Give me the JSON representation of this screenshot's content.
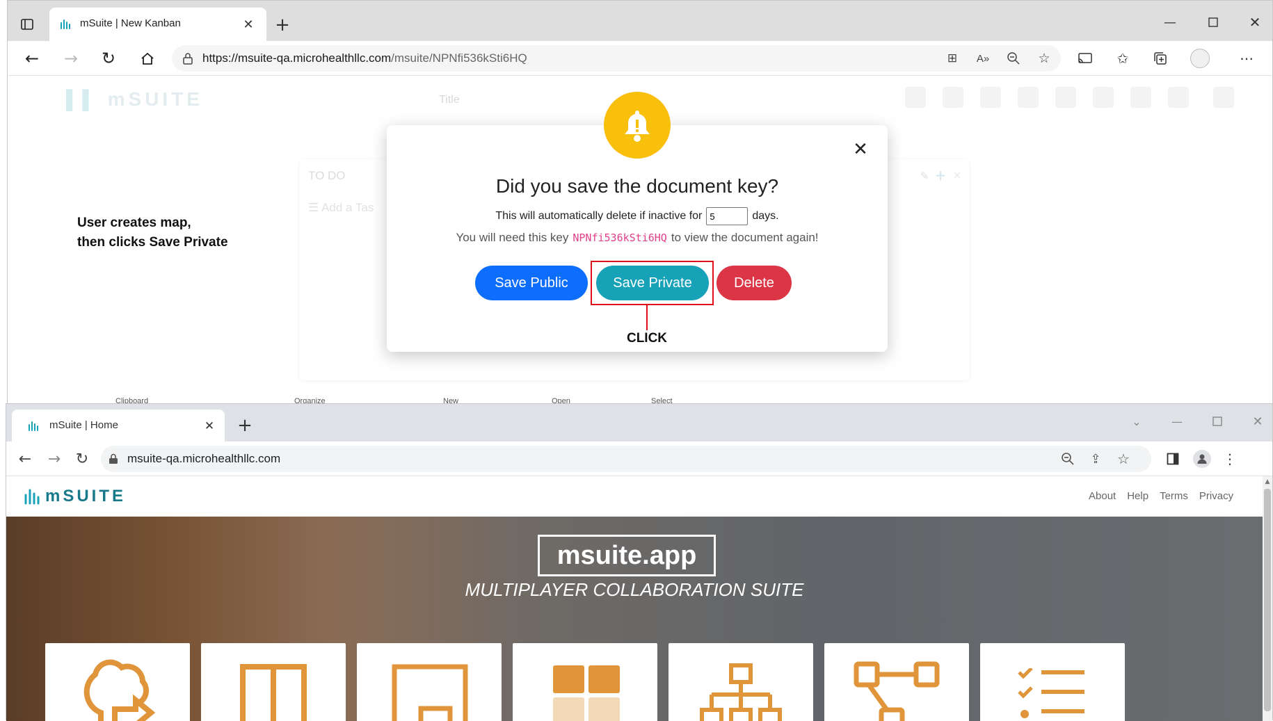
{
  "colors": {
    "accent_orange": "#e0953a",
    "brand_teal": "#17a2b8",
    "public_blue": "#0d6efd",
    "delete_red": "#dc3545",
    "bell_yellow": "#f8bf0b",
    "annotation_red": "#e0101a",
    "key_pink": "#e0408a"
  },
  "top_window": {
    "tab": {
      "title": "mSuite | New Kanban",
      "icon": "msuite-logo-icon"
    },
    "address": {
      "url_host": "https://msuite-qa.microhealthllc.com",
      "url_path": "/msuite/NPNfi536kSti6HQ"
    },
    "page": {
      "logo": "mSUITE",
      "title_placeholder": "Title",
      "board": {
        "column_title": "TO DO",
        "add_task": "Add a Tas"
      }
    },
    "annotation": {
      "line1": "User creates map,",
      "line2": "then clicks Save Private",
      "click_label": "CLICK"
    },
    "modal": {
      "heading": "Did you save the document key?",
      "inactive_prefix": "This will automatically delete if inactive for",
      "inactive_days": "5",
      "inactive_suffix": "days.",
      "key_prefix": "You will need this key",
      "key": "NPNfi536kSti6HQ",
      "key_suffix": "to view the document again!",
      "buttons": {
        "public": "Save Public",
        "private": "Save Private",
        "delete": "Delete"
      }
    },
    "ribbon_fragments": [
      "Clipboard",
      "Organize",
      "New",
      "Open",
      "Select"
    ]
  },
  "bottom_window": {
    "tab": {
      "title": "mSuite | Home",
      "icon": "msuite-logo-icon"
    },
    "address": {
      "url": "msuite-qa.microhealthllc.com"
    },
    "site": {
      "logo": "mSUITE",
      "nav": [
        "About",
        "Help",
        "Terms",
        "Privacy"
      ],
      "hero_title": "msuite.app",
      "hero_subtitle": "MULTIPLAYER COLLABORATION SUITE",
      "cards": [
        "mindmap-icon",
        "kanban-icon",
        "notepad-icon",
        "spreadsheet-icon",
        "org-chart-icon",
        "flowmap-icon",
        "todo-list-icon"
      ]
    }
  }
}
